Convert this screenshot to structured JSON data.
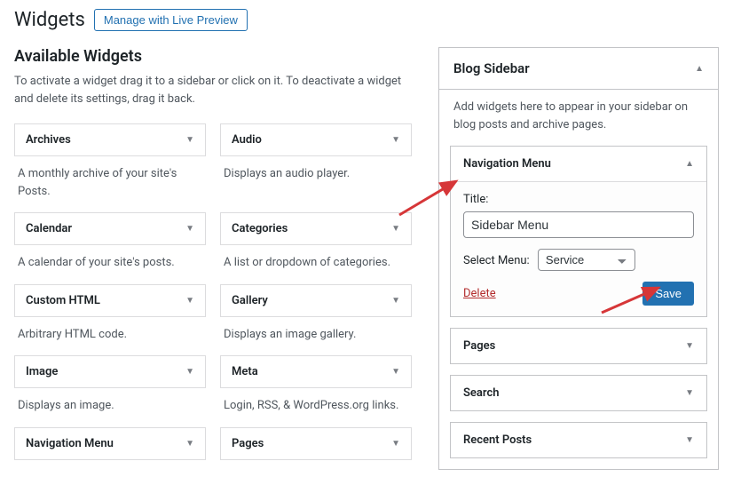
{
  "header": {
    "title": "Widgets",
    "preview_label": "Manage with Live Preview"
  },
  "available": {
    "title": "Available Widgets",
    "help": "To activate a widget drag it to a sidebar or click on it. To deactivate a widget and delete its settings, drag it back.",
    "widgets": [
      {
        "name": "Archives",
        "desc": "A monthly archive of your site's Posts."
      },
      {
        "name": "Audio",
        "desc": "Displays an audio player."
      },
      {
        "name": "Calendar",
        "desc": "A calendar of your site's posts."
      },
      {
        "name": "Categories",
        "desc": "A list or dropdown of categories."
      },
      {
        "name": "Custom HTML",
        "desc": "Arbitrary HTML code."
      },
      {
        "name": "Gallery",
        "desc": "Displays an image gallery."
      },
      {
        "name": "Image",
        "desc": "Displays an image."
      },
      {
        "name": "Meta",
        "desc": "Login, RSS, & WordPress.org links."
      },
      {
        "name": "Navigation Menu",
        "desc": ""
      },
      {
        "name": "Pages",
        "desc": ""
      }
    ]
  },
  "sidebar": {
    "title": "Blog Sidebar",
    "desc": "Add widgets here to appear in your sidebar on blog posts and archive pages.",
    "nav_widget": {
      "title": "Navigation Menu",
      "title_label": "Title:",
      "title_value": "Sidebar Menu",
      "select_label": "Select Menu:",
      "select_value": "Service",
      "delete_label": "Delete",
      "save_label": "Save"
    },
    "collapsed": [
      {
        "title": "Pages"
      },
      {
        "title": "Search"
      },
      {
        "title": "Recent Posts"
      }
    ]
  }
}
